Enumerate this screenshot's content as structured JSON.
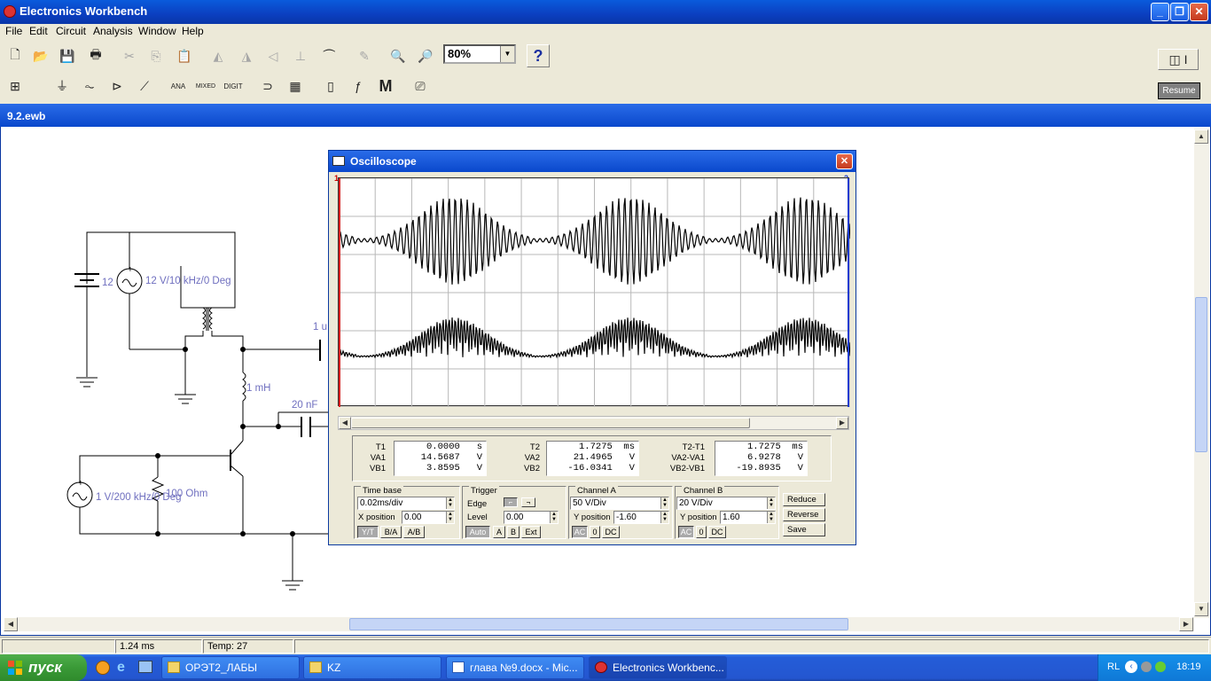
{
  "app": {
    "title": "Electronics Workbench"
  },
  "menu": [
    "File",
    "Edit",
    "Circuit",
    "Analysis",
    "Window",
    "Help"
  ],
  "toolbar": {
    "zoom": "80%",
    "help": "?",
    "resume": "Resume",
    "parts": [
      "ANA",
      "MIXED",
      "DIGIT",
      "M"
    ]
  },
  "document": {
    "title": "9.2.ewb"
  },
  "circuit": {
    "labels": {
      "dc_source": "12",
      "ac_source1": "12 V/10 kHz/0 Deg",
      "inductor": "1 mH",
      "cap1": "1 u",
      "cap2": "20 nF",
      "ac_source2": "1 V/200 kHz/0 Deg",
      "resistor": "100  Ohm"
    }
  },
  "oscilloscope": {
    "title": "Oscilloscope",
    "markers": [
      "1",
      "2"
    ],
    "readouts": {
      "t1": {
        "T1": "0.0000   s",
        "VA1": "14.5687   V",
        "VB1": "3.8595   V"
      },
      "t2": {
        "T2": "1.7275  ms",
        "VA2": "21.4965   V",
        "VB2": "-16.0341   V"
      },
      "diff": {
        "T2-T1": "1.7275  ms",
        "VA2-VA1": "6.9278   V",
        "VB2-VB1": "-19.8935   V"
      }
    },
    "timebase": {
      "label": "Time base",
      "value": "0.02ms/div",
      "xpos_label": "X position",
      "xpos": "0.00",
      "modes": [
        "Y/T",
        "B/A",
        "A/B"
      ]
    },
    "trigger": {
      "label": "Trigger",
      "edge_label": "Edge",
      "level_label": "Level",
      "level": "0.00",
      "modes": [
        "Auto",
        "A",
        "B",
        "Ext"
      ]
    },
    "channel_a": {
      "label": "Channel A",
      "scale": "50 V/Div",
      "ypos_label": "Y position",
      "ypos": "-1.60",
      "coupling": [
        "AC",
        "0",
        "DC"
      ]
    },
    "channel_b": {
      "label": "Channel B",
      "scale": "20 V/Div",
      "ypos_label": "Y position",
      "ypos": "1.60",
      "coupling": [
        "AC",
        "0",
        "DC"
      ]
    },
    "buttons": [
      "Reduce",
      "Reverse",
      "Save"
    ]
  },
  "status": {
    "time": "1.24 ms",
    "temp": "Temp:  27"
  },
  "taskbar": {
    "start": "пуск",
    "tasks": [
      "ОРЭТ2_ЛАБЫ",
      "KZ",
      "глава №9.docx - Mic...",
      "Electronics Workbenc..."
    ],
    "lang": "RL",
    "clock": "18:19"
  }
}
